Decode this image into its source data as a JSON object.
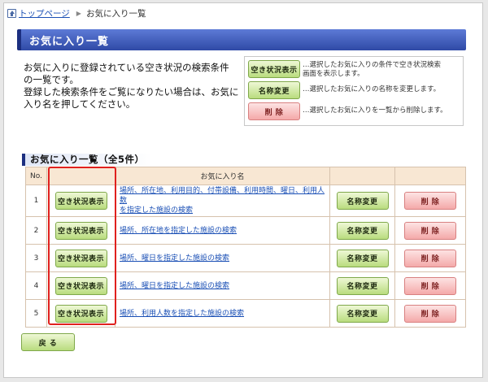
{
  "breadcrumb": {
    "home": "トップページ",
    "current": "お気に入り一覧"
  },
  "title": "お気に入り一覧",
  "intro": {
    "line1": "お気に入りに登録されている空き状況の検索条件",
    "line2": "の一覧です。",
    "line3": "登録した検索条件をご覧になりたい場合は、お気に",
    "line4": "入り名を押してください。"
  },
  "legend": [
    {
      "button": "空き状況表示",
      "desc1": "…選択したお気に入りの条件で空き状況検索",
      "desc2": "画面を表示します。"
    },
    {
      "button": "名称変更",
      "desc1": "…選択したお気に入りの名称を変更します。",
      "desc2": ""
    },
    {
      "button": "削 除",
      "desc1": "…選択したお気に入りを一覧から削除します。",
      "desc2": ""
    }
  ],
  "section_title": "お気に入り一覧（全5件）",
  "table": {
    "headers": {
      "no": "No.",
      "status": "",
      "name": "お気に入り名",
      "rename": "",
      "delete": ""
    },
    "status_label": "空き状況表示",
    "rename_label": "名称変更",
    "delete_label": "削 除",
    "rows": [
      {
        "no": "1",
        "name1": "場所、所在地、利用目的、付帯設備、利用時間、曜日、利用人数",
        "name2": "を指定した施設の検索"
      },
      {
        "no": "2",
        "name1": "場所、所在地を指定した施設の検索",
        "name2": ""
      },
      {
        "no": "3",
        "name1": "場所、曜日を指定した施設の検索",
        "name2": ""
      },
      {
        "no": "4",
        "name1": "場所、曜日を指定した施設の検索",
        "name2": ""
      },
      {
        "no": "5",
        "name1": "場所、利用人数を指定した施設の検索",
        "name2": ""
      }
    ]
  },
  "back_label": "戻 る",
  "colors": {
    "accent": "#2f4aa6",
    "highlight": "#e0211e",
    "header_bg": "#f8e7d3"
  }
}
